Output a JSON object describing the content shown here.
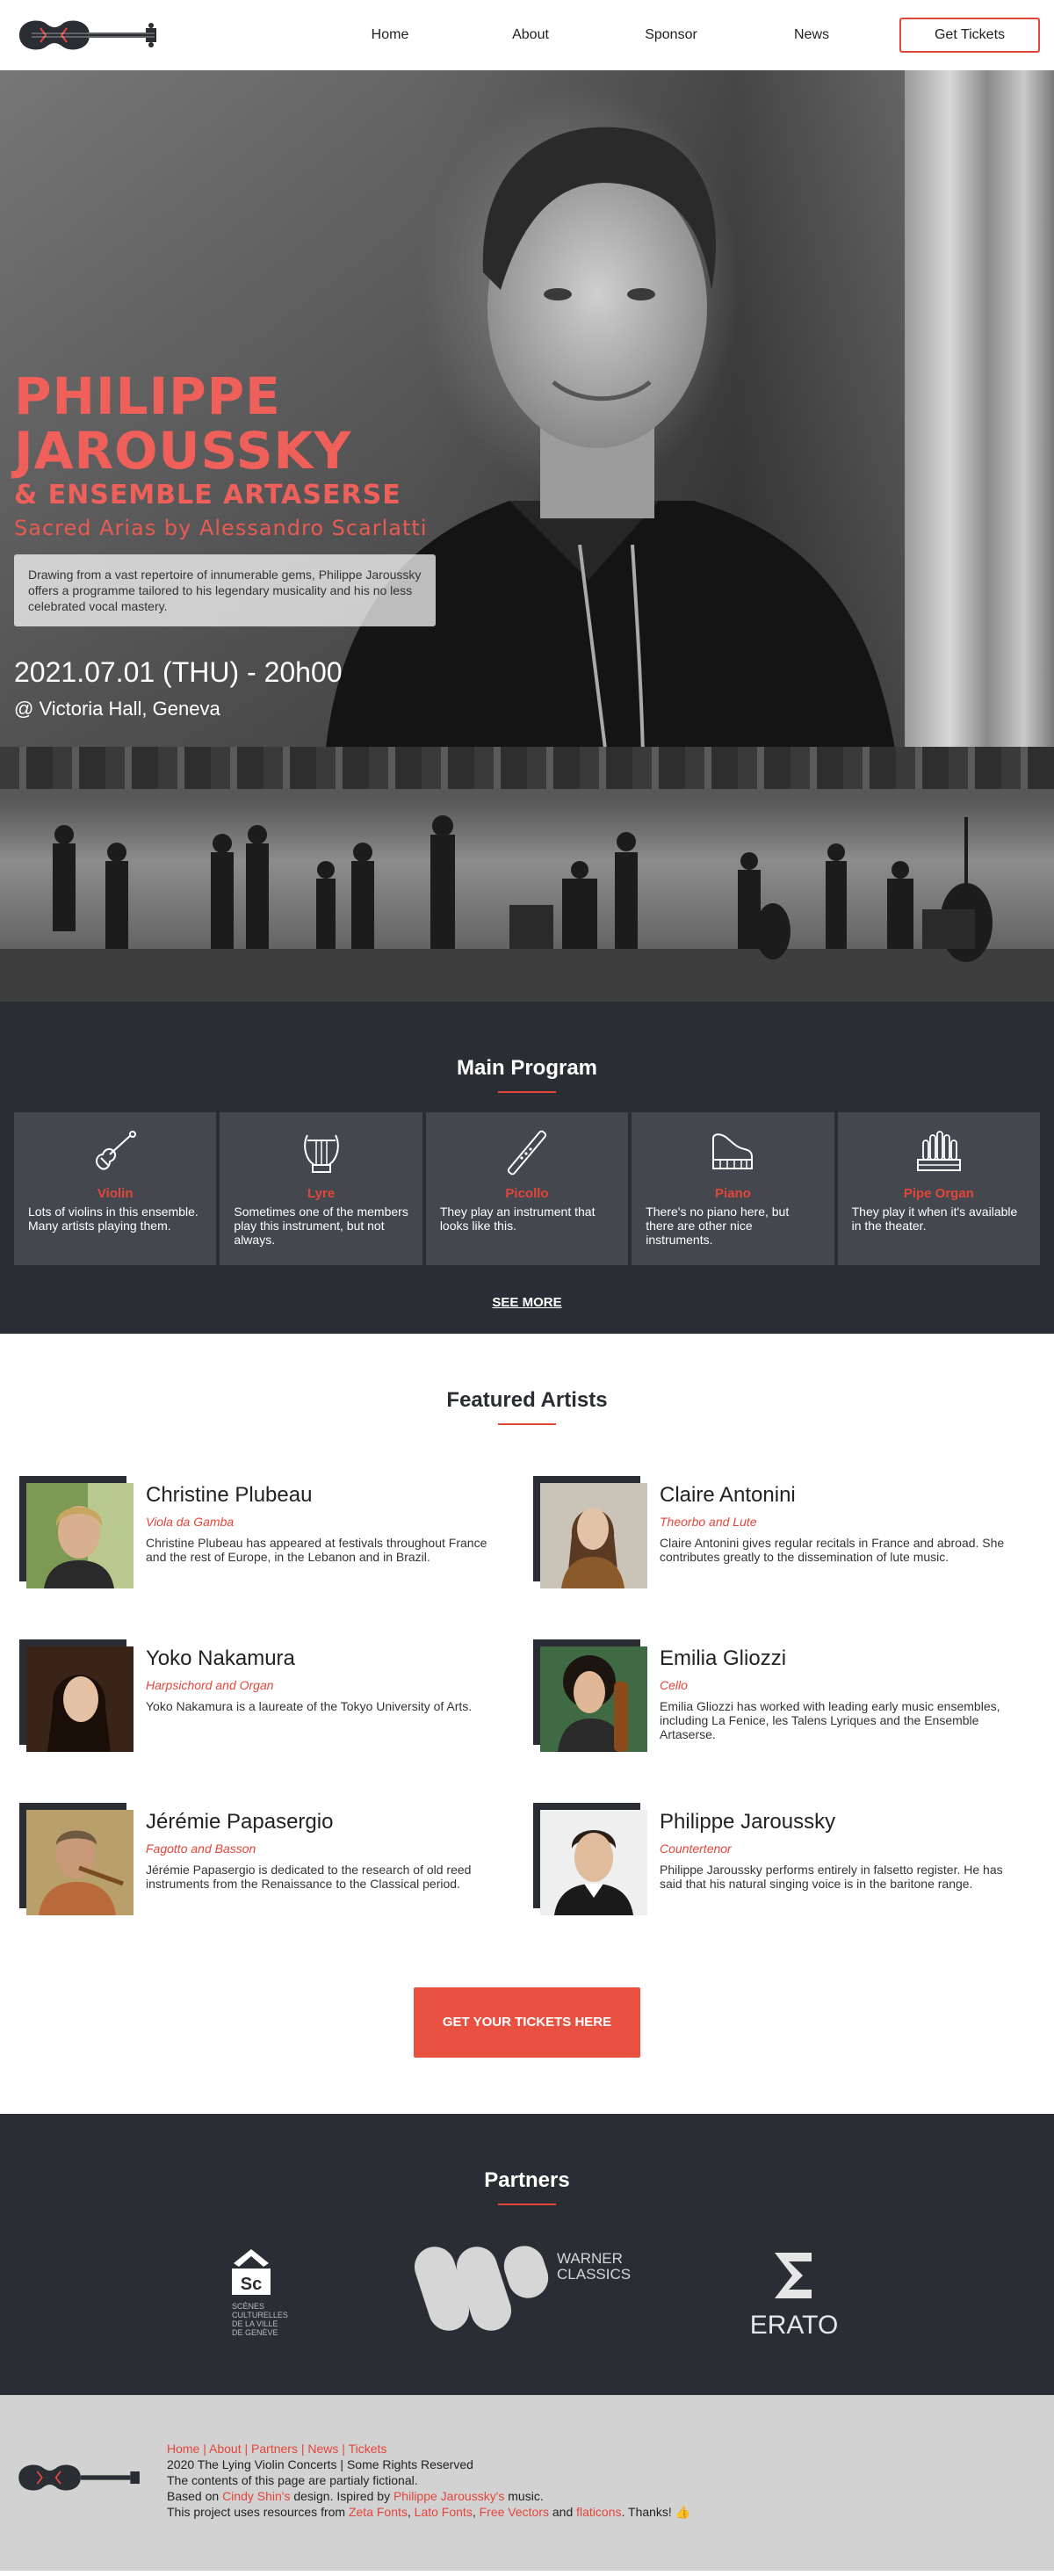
{
  "nav": {
    "items": [
      "Home",
      "About",
      "Sponsor",
      "News"
    ],
    "tickets": "Get Tickets"
  },
  "hero": {
    "title": "PHILIPPE JAROUSSKY",
    "subtitle": "& ENSEMBLE ARTASERSE",
    "program": "Sacred Arias by Alessandro Scarlatti",
    "blurb": "Drawing from a vast repertoire of innumerable gems, Philippe Jaroussky offers a programme tailored to his legendary musicality and his no less celebrated vocal mastery.",
    "date": "2021.07.01 (THU) - 20h00",
    "venue": "@ Victoria Hall, Geneva"
  },
  "program": {
    "title": "Main Program",
    "items": [
      {
        "name": "Violin",
        "desc": "Lots of violins in this ensemble. Many artists playing them.",
        "icon": "violin-icon"
      },
      {
        "name": "Lyre",
        "desc": "Sometimes one of the members play this instrument, but not always.",
        "icon": "lyre-icon"
      },
      {
        "name": "Picollo",
        "desc": "They play an instrument that looks like this.",
        "icon": "piccolo-icon"
      },
      {
        "name": "Piano",
        "desc": "There's no piano here, but there are other nice instruments.",
        "icon": "piano-icon"
      },
      {
        "name": "Pipe Organ",
        "desc": "They play it when it's available in the theater.",
        "icon": "pipe-organ-icon"
      }
    ],
    "see_more": "SEE MORE"
  },
  "featured": {
    "title": "Featured Artists",
    "artists": [
      {
        "name": "Christine Plubeau",
        "role": "Viola da Gamba",
        "bio": "Christine Plubeau has appeared at festivals throughout France and the rest of Europe, in the Lebanon and in Brazil."
      },
      {
        "name": "Claire Antonini",
        "role": "Theorbo and Lute",
        "bio": "Claire Antonini gives regular recitals in France and abroad. She contributes greatly to the dissemination of lute music."
      },
      {
        "name": "Yoko Nakamura",
        "role": "Harpsichord and Organ",
        "bio": "Yoko Nakamura is a laureate of the Tokyo University of Arts."
      },
      {
        "name": "Emilia Gliozzi",
        "role": "Cello",
        "bio": "Emilia Gliozzi has worked with leading early music ensembles, including La Fenice, les Talens Lyriques and the Ensemble Artaserse."
      },
      {
        "name": "Jérémie Papasergio",
        "role": "Fagotto and Basson",
        "bio": "Jérémie Papasergio is dedicated to the research of old reed instruments from the Renaissance to the Classical period."
      },
      {
        "name": "Philippe Jaroussky",
        "role": "Countertenor",
        "bio": "Philippe Jaroussky performs entirely in falsetto register. He has said that his natural singing voice is in the baritone range."
      }
    ],
    "cta": "GET YOUR TICKETS HERE"
  },
  "partners": {
    "title": "Partners",
    "logos": {
      "sc_mark": "Sc",
      "sc_text": [
        "SCÈNES",
        "CULTURELLES",
        "DE LA VILLE",
        "DE GENÈVE"
      ],
      "warner_text": [
        "WARNER",
        "CLASSICS"
      ],
      "erato_text": "ERATO"
    }
  },
  "footer": {
    "links": [
      "Home",
      "About",
      "Partners",
      "News",
      "Tickets"
    ],
    "sep": " | ",
    "copyright": "2020 The Lying Violin Concerts | Some Rights Reserved",
    "fiction": "The contents of this page are partialy fictional.",
    "based_prefix": "Based on ",
    "based_link": "Cindy Shin's",
    "based_mid": " design. Ispired by ",
    "inspired_link": "Philippe Jaroussky's",
    "based_suffix": " music.",
    "res_prefix": "This project uses resources from ",
    "res_links": [
      "Zeta Fonts",
      "Lato Fonts",
      "Free Vectors",
      "flaticons"
    ],
    "res_and": " and ",
    "res_comma": ", ",
    "res_suffix": ". Thanks! 👍"
  },
  "colors": {
    "accent": "#e4453a",
    "dark": "#2a2d33",
    "card": "#44474d",
    "footer": "#d2d2d2"
  }
}
